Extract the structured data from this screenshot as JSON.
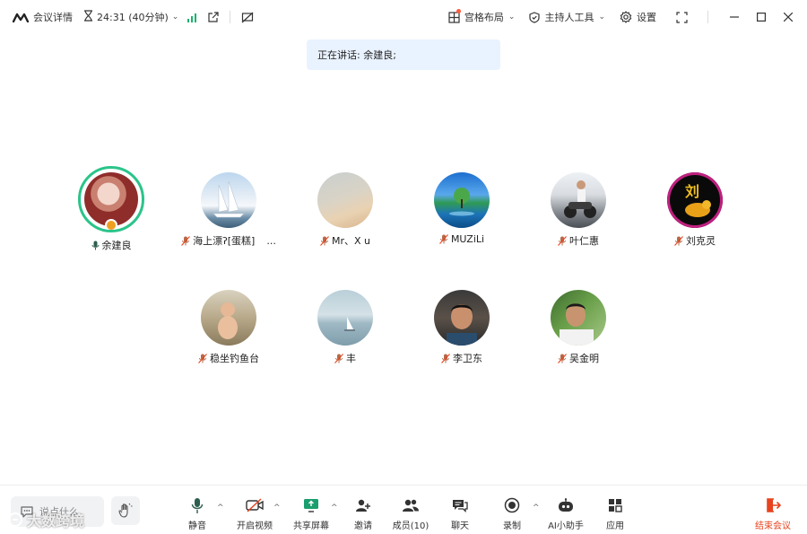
{
  "topbar": {
    "meeting_details": "会议详情",
    "timer": "24:31 (40分钟)",
    "layout_label": "宫格布局",
    "host_tools_label": "主持人工具",
    "settings_label": "设置"
  },
  "banner": {
    "speaking_text": "正在讲话: 余建良;"
  },
  "participants": [
    {
      "name": "余建良"
    },
    {
      "name": "海上漂ʔ[蛋糕]"
    },
    {
      "name": "Mr、X u"
    },
    {
      "name": "MUZiLi"
    },
    {
      "name": "叶仁惠"
    },
    {
      "name": "刘克灵"
    },
    {
      "name": "稳坐钓鱼台"
    },
    {
      "name": "丰"
    },
    {
      "name": "李卫东"
    },
    {
      "name": "吴金明"
    }
  ],
  "participant_extra": "...",
  "avatar_text": {
    "liu": "刘"
  },
  "bottombar": {
    "say_placeholder": "说点什么",
    "mute": "静音",
    "video": "开启视频",
    "share": "共享屏幕",
    "invite": "邀请",
    "members": "成员(10)",
    "chat": "聊天",
    "record": "录制",
    "ai": "AI小助手",
    "apps": "应用",
    "end": "结束会议"
  },
  "watermark": "大数跨境",
  "colors": {
    "speaker_ring": "#2bc48a",
    "signal": "#19b26a",
    "end": "#e8431e",
    "banner_bg": "#e9f2ff"
  },
  "icons": [
    "meeting-logo-icon",
    "hourglass-icon",
    "signal-icon",
    "external-link-icon",
    "no-screen-icon",
    "grid-layout-icon",
    "shield-icon",
    "gear-icon",
    "fullscreen-icon",
    "minimize-icon",
    "maximize-icon",
    "close-icon",
    "mic-icon",
    "mic-muted-icon",
    "camera-off-icon",
    "share-screen-icon",
    "invite-icon",
    "members-icon",
    "chat-icon",
    "record-icon",
    "ai-assistant-icon",
    "apps-icon",
    "end-meeting-icon",
    "raise-hand-icon"
  ]
}
